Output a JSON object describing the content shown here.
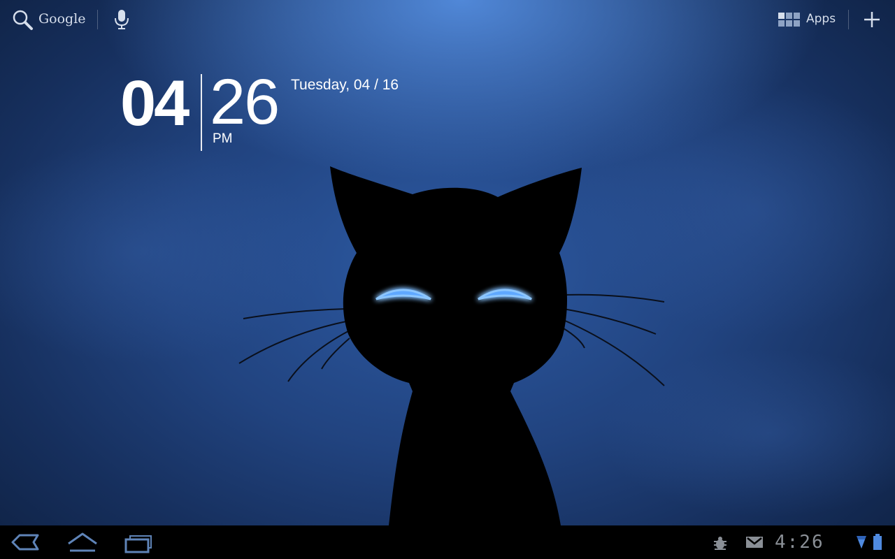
{
  "topbar": {
    "search_label": "Google",
    "apps_label": "Apps"
  },
  "clock_widget": {
    "hour": "04",
    "minute": "26",
    "ampm": "PM",
    "date": "Tuesday, 04 / 16"
  },
  "status_bar": {
    "time": "4:26"
  },
  "icons": {
    "search": "search-icon",
    "mic": "microphone-icon",
    "apps": "apps-grid-icon",
    "add": "plus-icon",
    "back": "back-icon",
    "home": "home-icon",
    "recent": "recent-apps-icon",
    "debug": "usb-debugging-icon",
    "gmail": "gmail-icon",
    "wifi": "wifi-icon",
    "battery": "battery-icon"
  },
  "colors": {
    "wallpaper_top": "#4a8ae0",
    "wallpaper_mid": "#21437f",
    "wallpaper_dark": "#0f2244",
    "cat_eye_glow": "#5fa8ff",
    "nav_bar": "#000000",
    "nav_icon": "#5f84b8",
    "status_icon": "#8a8f96"
  }
}
